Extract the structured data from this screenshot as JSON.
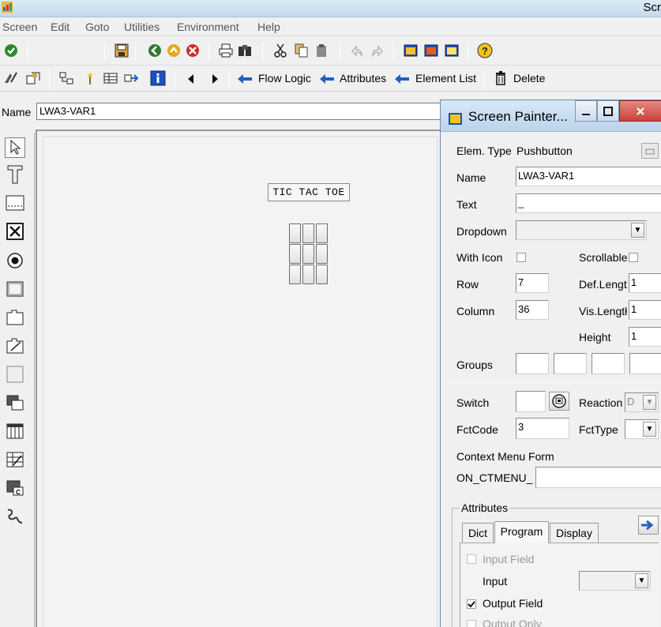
{
  "window": {
    "title_fragment": "Scr"
  },
  "menu": [
    "Screen",
    "Edit",
    "Goto",
    "Utilities",
    "Environment",
    "Help"
  ],
  "toolbar2": {
    "flow_logic": "Flow Logic",
    "attributes": "Attributes",
    "element_list": "Element List",
    "delete": "Delete"
  },
  "name_row": {
    "label": "Name",
    "value": "LWA3-VAR1"
  },
  "canvas": {
    "title_box": "TIC TAC TOE",
    "grid_rows": 3,
    "grid_cols": 3
  },
  "dialog": {
    "title": "Screen Painter...",
    "elem_type_label": "Elem. Type",
    "elem_type_value": "Pushbutton",
    "name_label": "Name",
    "name_value": "LWA3-VAR1",
    "text_label": "Text",
    "text_value": "_",
    "dropdown_label": "Dropdown",
    "with_icon_label": "With Icon",
    "scrollable_label": "Scrollable",
    "row_label": "Row",
    "row_value": "7",
    "def_length_label": "Def.Lengt",
    "def_length_value": "1",
    "column_label": "Column",
    "column_value": "36",
    "vis_length_label": "Vis.Lengtł",
    "vis_length_value": "1",
    "height_label": "Height",
    "height_value": "1",
    "groups_label": "Groups",
    "switch_label": "Switch",
    "reaction_label": "Reaction",
    "reaction_value": "D",
    "fctcode_label": "FctCode",
    "fctcode_value": "3",
    "fcttype_label": "FctType",
    "context_menu_label": "Context Menu Form",
    "context_menu_prefix": "ON_CTMENU_",
    "attributes_group": "Attributes",
    "tabs": [
      "Dict",
      "Program",
      "Display"
    ],
    "input_field_label": "Input Field",
    "input_label": "Input",
    "output_field_label": "Output Field",
    "output_only_label": "Output Only"
  },
  "colors": {
    "accent_blue": "#1f5fbf",
    "title_grad": "#c4d9ec",
    "close_red": "#c9413a"
  }
}
